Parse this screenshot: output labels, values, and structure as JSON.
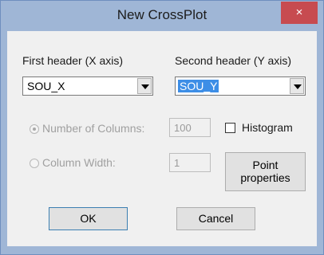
{
  "window": {
    "title": "New CrossPlot",
    "close_glyph": "×"
  },
  "x_header": {
    "label": "First header (X axis)",
    "value": "SOU_X"
  },
  "y_header": {
    "label": "Second header (Y axis)",
    "value": "SOU_Y"
  },
  "bins": {
    "num_columns_label": "Number of Columns:",
    "num_columns_value": "100",
    "col_width_label": "Column Width:",
    "col_width_value": "1",
    "selected": "num_columns"
  },
  "histogram": {
    "label": "Histogram",
    "checked": false
  },
  "buttons": {
    "point_props_line1": "Point",
    "point_props_line2": "properties",
    "ok": "OK",
    "cancel": "Cancel"
  }
}
